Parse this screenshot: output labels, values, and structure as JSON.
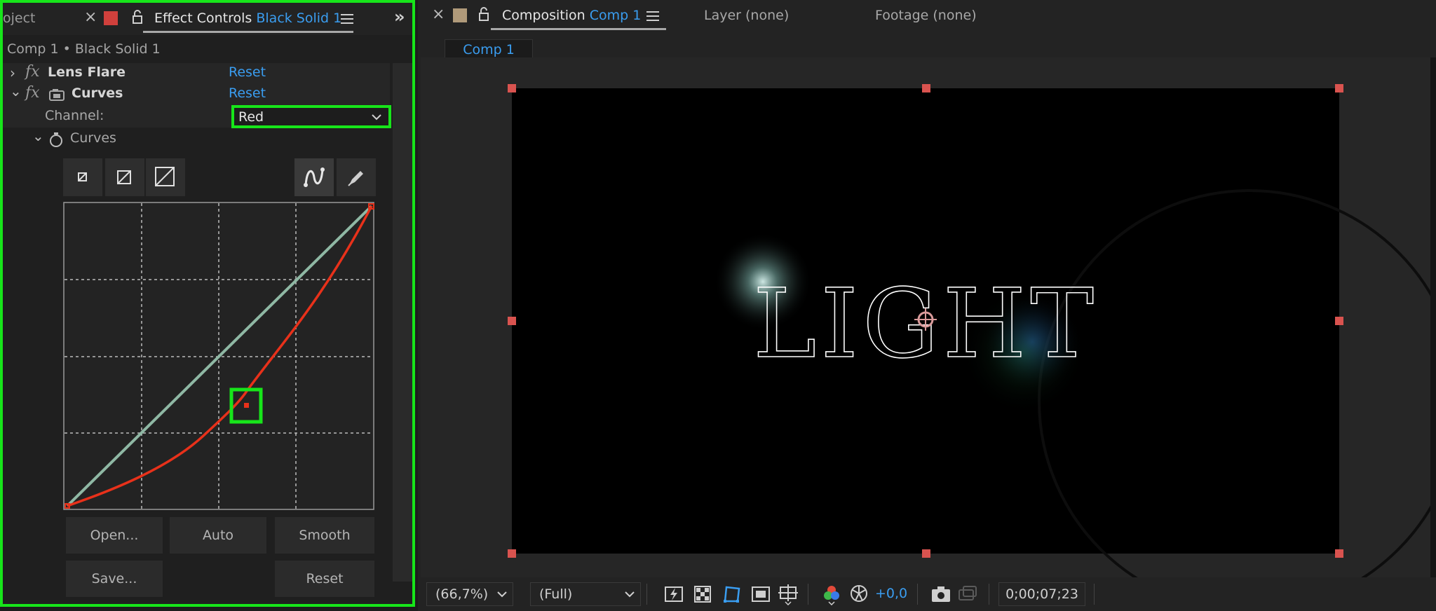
{
  "left_panel": {
    "tabs": {
      "project_partial": "oject",
      "effect_controls": "Effect Controls",
      "effect_controls_layer": "Black Solid 1"
    },
    "breadcrumb": "Comp 1 • Black Solid 1",
    "effects": [
      {
        "name": "Lens Flare",
        "reset": "Reset"
      },
      {
        "name": "Curves",
        "reset": "Reset"
      }
    ],
    "channel": {
      "label": "Channel:",
      "value": "Red"
    },
    "curves_prop": "Curves",
    "buttons": {
      "open": "Open...",
      "auto": "Auto",
      "smooth": "Smooth",
      "save": "Save...",
      "reset": "Reset"
    }
  },
  "right_panel": {
    "tabs": {
      "composition": "Composition",
      "composition_name": "Comp 1",
      "layer": "Layer (none)",
      "footage": "Footage (none)"
    },
    "comp_tab": "Comp 1",
    "viewer_text": "LIGHT",
    "bottom_bar": {
      "zoom": "(66,7%)",
      "resolution": "(Full)",
      "exposure": "+0,0",
      "timecode": "0;00;07;23"
    }
  },
  "colors": {
    "highlight": "#17e51a",
    "accent_blue": "#3a9df0",
    "curve_red": "#e8311a",
    "curve_diagonal": "#8fb8a4",
    "handle": "#d9534f"
  }
}
